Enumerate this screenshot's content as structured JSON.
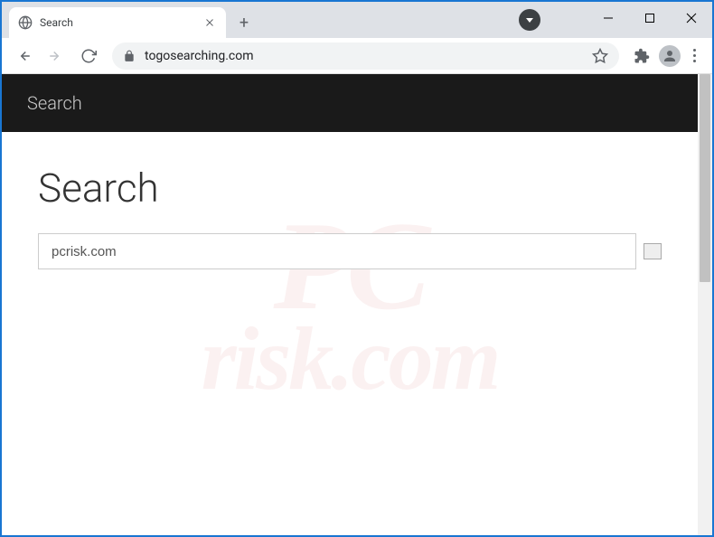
{
  "window": {
    "tab_title": "Search"
  },
  "address": {
    "url": "togosearching.com"
  },
  "page": {
    "header_title": "Search",
    "heading": "Search",
    "search_value": "pcrisk.com"
  },
  "watermark": {
    "line1": "PC",
    "line2": "risk.com"
  }
}
